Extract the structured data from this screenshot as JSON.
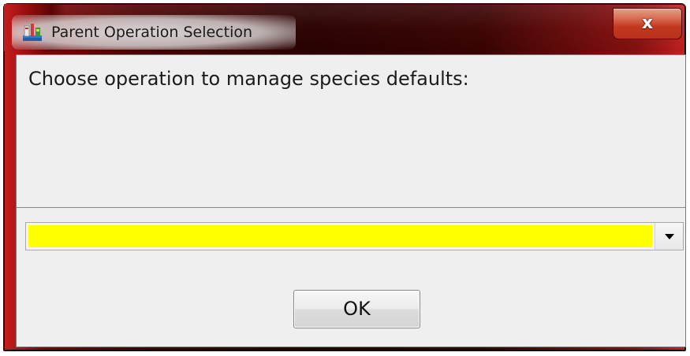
{
  "window": {
    "title": "Parent Operation Selection",
    "app_icon": "java-app-icon",
    "close_glyph": "x",
    "close_icon": "close-icon"
  },
  "dialog": {
    "prompt": "Choose operation to manage species defaults:",
    "operation_select": {
      "selected_value": "",
      "background_color": "#ffff00",
      "arrow_icon": "dropdown-arrow-icon"
    },
    "ok_label": "OK"
  },
  "colors": {
    "titlebar": "#4a0202",
    "frame_accent": "#c41f1f",
    "close_button": "#c2391f",
    "client_background": "#efefef"
  }
}
